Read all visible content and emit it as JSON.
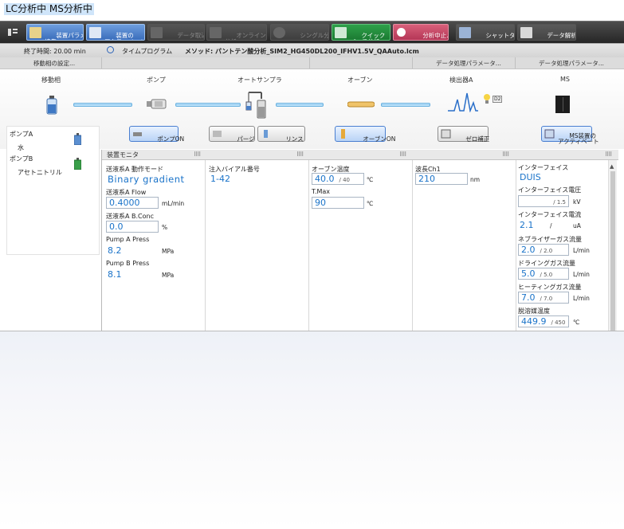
{
  "title": "LC分析中 MS分析中",
  "toolbar": [
    {
      "label": "装置パラメータ\n編集",
      "style": "blue",
      "icon": "edit-params-icon"
    },
    {
      "label": "装置の\nアクティベート",
      "style": "blue",
      "icon": "activate-icon"
    },
    {
      "label": "データ取込",
      "style": "dark",
      "icon": "data-acquire-icon"
    },
    {
      "label": "オンライン\n分析",
      "style": "dark",
      "icon": "online-analysis-icon"
    },
    {
      "label": "シングル分析",
      "style": "dark",
      "icon": "single-run-icon"
    },
    {
      "label": "クイック\nバッチ分析...",
      "style": "green",
      "icon": "quick-batch-icon"
    },
    {
      "label": "分析中止...",
      "style": "pink",
      "icon": "stop-icon"
    },
    {
      "label": "シャットダウン...",
      "style": "gray",
      "icon": "shutdown-icon"
    },
    {
      "label": "データ解析",
      "style": "gray",
      "icon": "data-analysis-icon"
    }
  ],
  "method_row": {
    "end_time": "終了時間: 20.00 min",
    "time_program": "タイムプログラム",
    "method_label": "メソッド:",
    "method_file": "パントテン酸分析_SIM2_HG450DL200_IFHV1.5V_QAAuto.lcm"
  },
  "header_row": {
    "mobile_phase_settings": "移動相の設定...",
    "data_params_1": "データ処理パラメータ...",
    "data_params_2": "データ処理パラメータ..."
  },
  "flow": {
    "labels": [
      "移動相",
      "ポンプ",
      "オートサンプラ",
      "オーブン",
      "検出器A",
      "MS"
    ],
    "buttons": {
      "pump_on": "ポンプON",
      "purge": "パージ",
      "rinse": "リンス",
      "oven_on": "オーブンON",
      "zero": "ゼロ補正",
      "ms_activate": "MS装置の\nアクティベート"
    }
  },
  "left_panel": {
    "pump_a": "ポンプA",
    "pump_a_solvent": "水",
    "pump_b": "ポンプB",
    "pump_b_solvent": "アセトニトリル"
  },
  "monitor": {
    "title": "装置モニタ",
    "pump": {
      "mode_label": "送液系A 動作モード",
      "mode_value": "Binary gradient",
      "flow_label": "送液系A Flow",
      "flow_value": "0.4000",
      "flow_unit": "mL/min",
      "bconc_label": "送液系A B.Conc",
      "bconc_value": "0.0",
      "bconc_unit": "%",
      "press_a_label": "Pump A Press",
      "press_a_value": "8.2",
      "press_a_unit": "MPa",
      "press_b_label": "Pump B Press",
      "press_b_value": "8.1",
      "press_b_unit": "MPa"
    },
    "autosampler": {
      "vial_label": "注入バイアル番号",
      "vial_value": "1-42"
    },
    "oven": {
      "temp_label": "オーブン温度",
      "temp_value": "40.0",
      "temp_set": "/ 40",
      "temp_unit": "℃",
      "tmax_label": "T.Max",
      "tmax_value": "90",
      "tmax_unit": "℃"
    },
    "detector": {
      "wl_label": "波長Ch1",
      "wl_value": "210",
      "wl_unit": "nm"
    },
    "ms": {
      "interface_label": "インターフェイス",
      "interface_value": "DUIS",
      "iv_label": "インターフェイス電圧",
      "iv_set": "/ 1.5",
      "iv_unit": "kV",
      "ic_label": "インターフェイス電流",
      "ic_value": "2.1",
      "ic_set": "/",
      "ic_unit": "uA",
      "neb_label": "ネブライザーガス流量",
      "neb_value": "2.0",
      "neb_set": "/ 2.0",
      "neb_unit": "L/min",
      "dry_label": "ドライングガス流量",
      "dry_value": "5.0",
      "dry_set": "/ 5.0",
      "dry_unit": "L/min",
      "heat_label": "ヒーティングガス流量",
      "heat_value": "7.0",
      "heat_set": "/ 7.0",
      "heat_unit": "L/min",
      "block_label": "脱溶媒温度",
      "block_value": "449.9",
      "block_set": "/ 450",
      "block_unit": "℃"
    }
  }
}
